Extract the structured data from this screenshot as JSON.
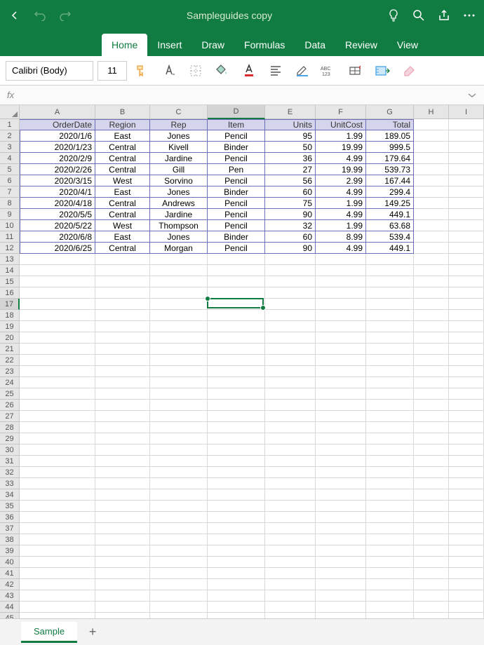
{
  "title": "Sampleguides copy",
  "tabs": [
    "Home",
    "Insert",
    "Draw",
    "Formulas",
    "Data",
    "Review",
    "View"
  ],
  "activeTab": "Home",
  "font": {
    "name": "Calibri (Body)",
    "size": "11"
  },
  "formulaBar": {
    "fx": "fx",
    "value": ""
  },
  "columns": [
    "A",
    "B",
    "C",
    "D",
    "E",
    "F",
    "G",
    "H",
    "I"
  ],
  "selectedColumn": "D",
  "selectedRow": 17,
  "rowCount": 47,
  "headers": [
    "OrderDate",
    "Region",
    "Rep",
    "Item",
    "Units",
    "UnitCost",
    "Total"
  ],
  "data": [
    [
      "2020/1/6",
      "East",
      "Jones",
      "Pencil",
      "95",
      "1.99",
      "189.05"
    ],
    [
      "2020/1/23",
      "Central",
      "Kivell",
      "Binder",
      "50",
      "19.99",
      "999.5"
    ],
    [
      "2020/2/9",
      "Central",
      "Jardine",
      "Pencil",
      "36",
      "4.99",
      "179.64"
    ],
    [
      "2020/2/26",
      "Central",
      "Gill",
      "Pen",
      "27",
      "19.99",
      "539.73"
    ],
    [
      "2020/3/15",
      "West",
      "Sorvino",
      "Pencil",
      "56",
      "2.99",
      "167.44"
    ],
    [
      "2020/4/1",
      "East",
      "Jones",
      "Binder",
      "60",
      "4.99",
      "299.4"
    ],
    [
      "2020/4/18",
      "Central",
      "Andrews",
      "Pencil",
      "75",
      "1.99",
      "149.25"
    ],
    [
      "2020/5/5",
      "Central",
      "Jardine",
      "Pencil",
      "90",
      "4.99",
      "449.1"
    ],
    [
      "2020/5/22",
      "West",
      "Thompson",
      "Pencil",
      "32",
      "1.99",
      "63.68"
    ],
    [
      "2020/6/8",
      "East",
      "Jones",
      "Binder",
      "60",
      "8.99",
      "539.4"
    ],
    [
      "2020/6/25",
      "Central",
      "Morgan",
      "Pencil",
      "90",
      "4.99",
      "449.1"
    ]
  ],
  "sheetTab": "Sample",
  "colors": {
    "primary": "#107c41",
    "headerFill": "#d4d5ec",
    "tableBorder": "#6b6db8"
  }
}
